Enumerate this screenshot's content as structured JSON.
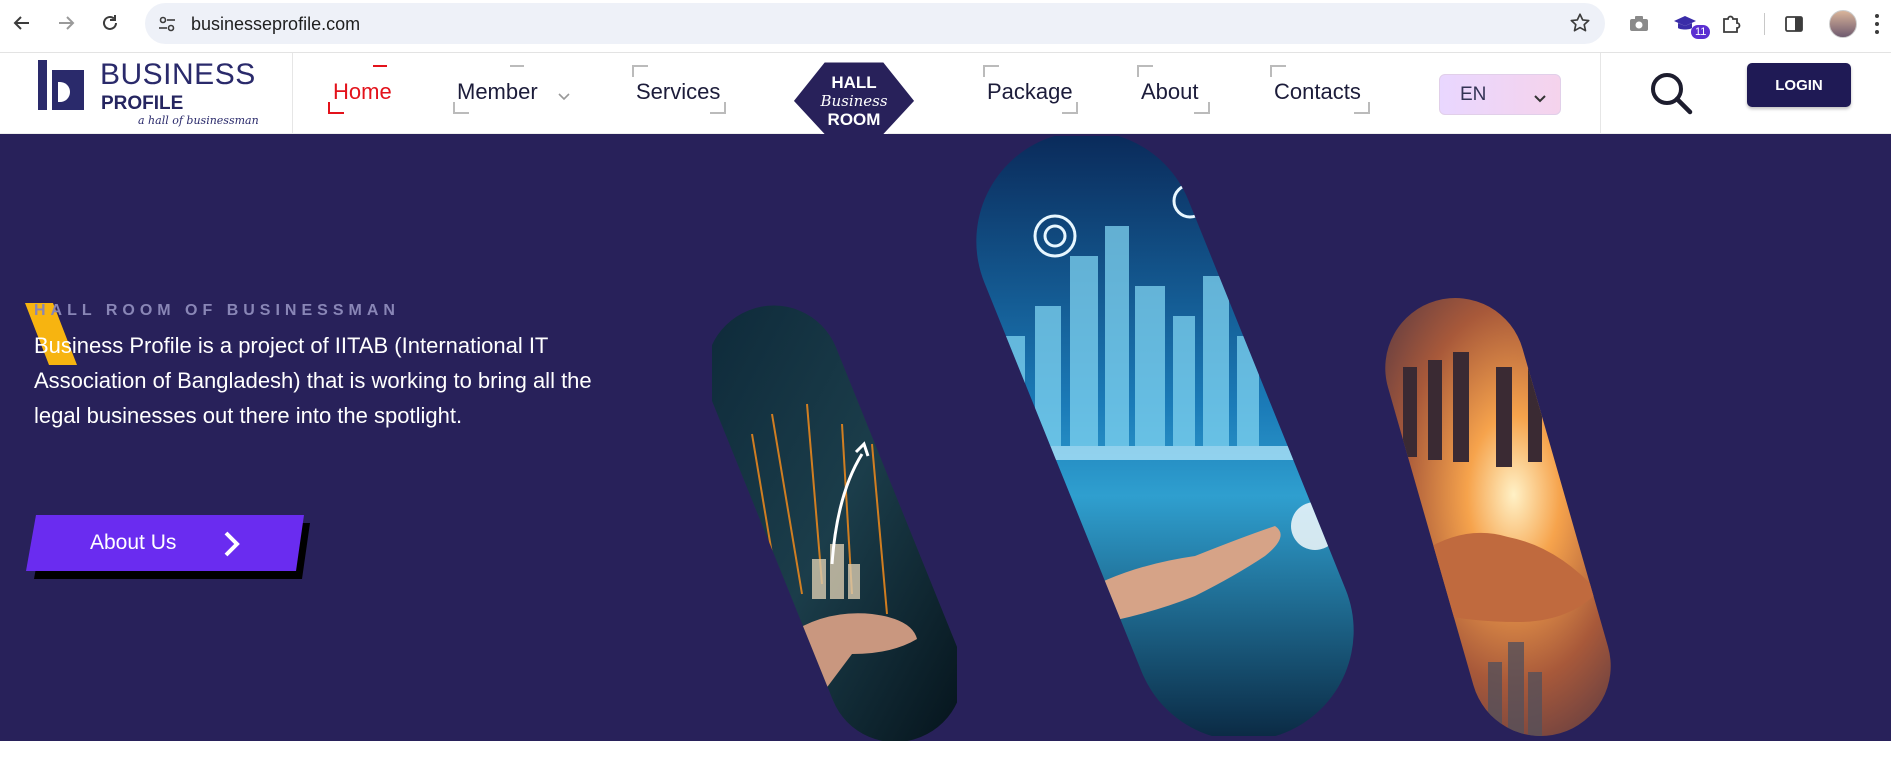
{
  "browser": {
    "url": "businesseprofile.com",
    "extension_badge": "11"
  },
  "header": {
    "logo": {
      "brand_top": "BUSINESS",
      "brand_mid": "PROFILE",
      "tagline": "a hall of businessman"
    },
    "nav": [
      {
        "label": "Home",
        "active": true
      },
      {
        "label": "Member",
        "has_dropdown": true
      },
      {
        "label": "Services"
      },
      {
        "label": "Package"
      },
      {
        "label": "About"
      },
      {
        "label": "Contacts"
      }
    ],
    "emblem": {
      "line1": "HALL",
      "line2": "Business",
      "line3": "ROOM"
    },
    "language": {
      "selected": "EN"
    },
    "login_label": "LOGIN"
  },
  "hero": {
    "eyebrow": "HALL ROOM OF BUSINESSMAN",
    "description": "Business Profile is a project of IITAB (International IT Association of Bangladesh) that is working to bring all the legal businesses out there into the spotlight.",
    "cta_label": "About Us"
  },
  "colors": {
    "hero_bg": "#28215a",
    "active_nav": "#e3121b",
    "cta_bg": "#6a2cf0",
    "accent_yellow": "#f7b410",
    "login_bg": "#1f1a55"
  },
  "icons": [
    "back-arrow-icon",
    "forward-arrow-icon",
    "reload-icon",
    "site-settings-icon",
    "bookmark-star-icon",
    "camera-icon",
    "graduation-cap-extension-icon",
    "puzzle-extensions-icon",
    "side-panel-icon",
    "search-icon",
    "chevron-right-icon",
    "chevron-down-icon"
  ]
}
